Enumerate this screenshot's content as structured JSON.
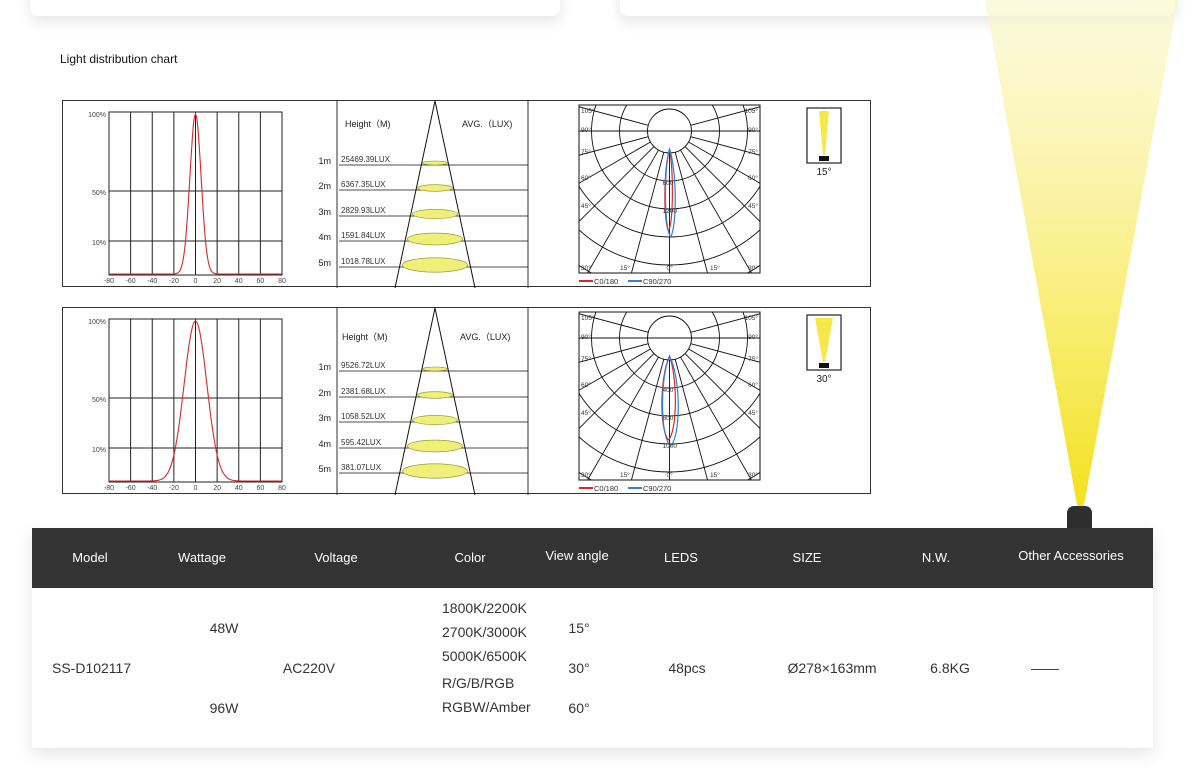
{
  "section_title": "Light distribution chart",
  "colors": {
    "beam": "#f7e84a",
    "header_bg": "#333333",
    "curve_red": "#d62828",
    "curve_blue": "#2f80d6",
    "ellipse_fill": "#eef07a"
  },
  "panels": [
    {
      "curve": {
        "y_ticks": [
          "100%",
          "50%",
          "10%"
        ],
        "x_ticks": [
          "-80",
          "-60",
          "-40",
          "-20",
          "0",
          "20",
          "40",
          "60",
          "80"
        ]
      },
      "cone": {
        "height_label": "Height（M)",
        "avg_label": "AVG.（LUX)",
        "rows": [
          {
            "height": "1m",
            "lux": "25469.39LUX"
          },
          {
            "height": "2m",
            "lux": "6367.35LUX"
          },
          {
            "height": "3m",
            "lux": "2829.93LUX"
          },
          {
            "height": "4m",
            "lux": "1591.84LUX"
          },
          {
            "height": "5m",
            "lux": "1018.78LUX"
          }
        ]
      },
      "polar": {
        "angle_labels": [
          "105°",
          "90°",
          "75°",
          "60°",
          "45°",
          "30°",
          "15°",
          "0°",
          "15°",
          "30°",
          "45°",
          "60°",
          "75°",
          "90°",
          "105°"
        ],
        "ring_labels": [
          "600",
          "1200"
        ],
        "legend": [
          "C0/180",
          "C90/270"
        ]
      },
      "beam_angle": "15°"
    },
    {
      "curve": {
        "y_ticks": [
          "100%",
          "50%",
          "10%"
        ],
        "x_ticks": [
          "-80",
          "-60",
          "-40",
          "-20",
          "0",
          "20",
          "40",
          "60",
          "80"
        ]
      },
      "cone": {
        "height_label": "Height（M)",
        "avg_label": "AVG.（LUX)",
        "rows": [
          {
            "height": "1m",
            "lux": "9526.72LUX"
          },
          {
            "height": "2m",
            "lux": "2381.68LUX"
          },
          {
            "height": "3m",
            "lux": "1058.52LUX"
          },
          {
            "height": "4m",
            "lux": "595.42LUX"
          },
          {
            "height": "5m",
            "lux": "381.07LUX"
          }
        ]
      },
      "polar": {
        "angle_labels": [
          "105°",
          "90°",
          "75°",
          "60°",
          "45°",
          "30°",
          "15°",
          "0°",
          "15°",
          "30°",
          "45°",
          "60°",
          "75°",
          "90°",
          "105°"
        ],
        "ring_labels": [
          "400",
          "600",
          "1000"
        ],
        "legend": [
          "C0/180",
          "C90/270"
        ]
      },
      "beam_angle": "30°"
    }
  ],
  "spec_table": {
    "headers": [
      "Model",
      "Wattage",
      "Voltage",
      "Color",
      "View angle",
      "LEDS",
      "SIZE",
      "N.W.",
      "Other Accessories"
    ],
    "model": "SS-D102117",
    "wattage": [
      "48W",
      "96W"
    ],
    "voltage": "AC220V",
    "colors": [
      "1800K/2200K",
      "2700K/3000K",
      "5000K/6500K",
      "R/G/B/RGB",
      "RGBW/Amber"
    ],
    "view_angles": [
      "15°",
      "30°",
      "60°"
    ],
    "leds": "48pcs",
    "size": "Ø278×163mm",
    "nw": "6.8KG",
    "accessories": "——"
  }
}
